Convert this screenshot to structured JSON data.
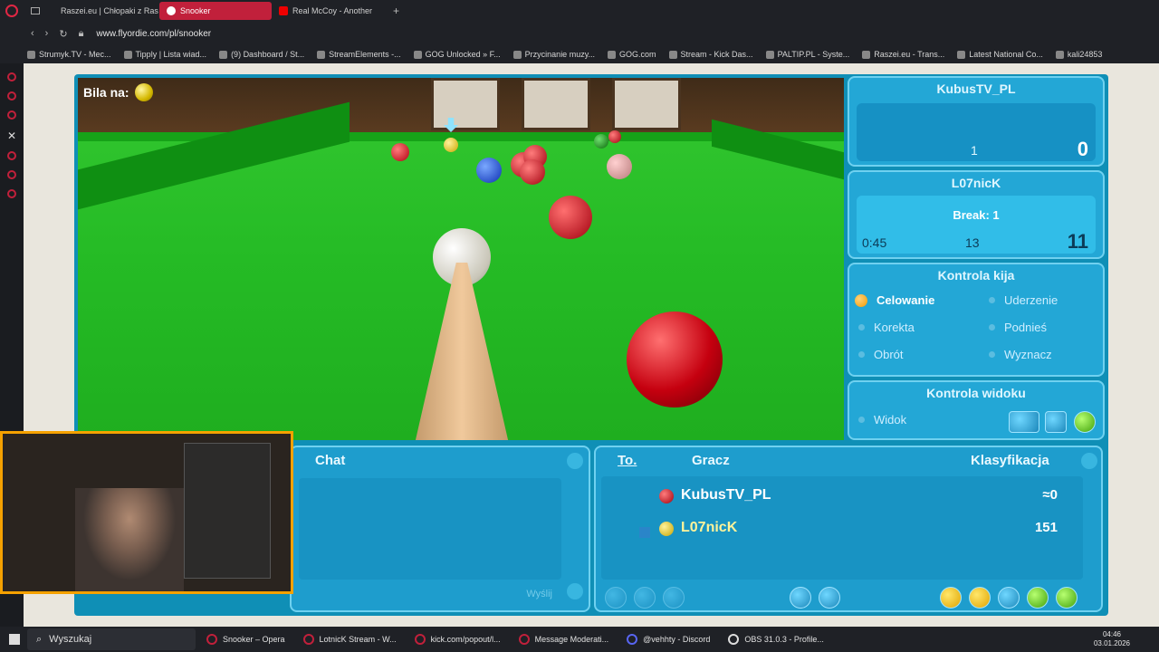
{
  "browser": {
    "tabs": [
      {
        "label": "Raszei.eu | Chłopaki z Ras",
        "active": false,
        "icon": "raszei-icon"
      },
      {
        "label": "Snooker",
        "active": true,
        "icon": "opera-icon"
      },
      {
        "label": "Real McCoy - Another",
        "active": false,
        "icon": "youtube-icon"
      }
    ],
    "url": "www.flyordie.com/pl/snooker",
    "bookmarks": [
      "Strumyk.TV - Mec...",
      "Tipply | Lista wiad...",
      "(9) Dashboard / St...",
      "StreamElements -...",
      "GOG Unlocked » F...",
      "Przycinanie muzy...",
      "GOG.com",
      "Stream - Kick Das...",
      "PALTIP.PL - Syste...",
      "Raszei.eu - Trans...",
      "Latest National Co...",
      "kali24853"
    ]
  },
  "game": {
    "cue_ball_label": "Bila na:",
    "player1": {
      "name": "KubusTV_PL",
      "frames": "1",
      "score": "0"
    },
    "player2": {
      "name": "L07nicK",
      "break": "Break: 1",
      "time": "0:45",
      "frames": "13",
      "score": "11"
    },
    "cue_control": {
      "title": "Kontrola kija",
      "items": [
        {
          "label": "Celowanie",
          "selected": true
        },
        {
          "label": "Uderzenie",
          "selected": false
        },
        {
          "label": "Korekta",
          "selected": false
        },
        {
          "label": "Podnieś",
          "selected": false
        },
        {
          "label": "Obrót",
          "selected": false
        },
        {
          "label": "Wyznacz",
          "selected": false
        }
      ]
    },
    "view_control": {
      "title": "Kontrola widoku",
      "item": "Widok"
    },
    "chat": {
      "title": "Chat",
      "send": "Wyślij"
    },
    "players_table": {
      "col_to": "To.",
      "col_player": "Gracz",
      "col_rank": "Klasyfikacja",
      "rows": [
        {
          "name": "KubusTV_PL",
          "rank": "≈0",
          "ball_color": "#c8101a"
        },
        {
          "name": "L07nicK",
          "rank": "151",
          "ball_color": "#e2c300"
        }
      ]
    }
  },
  "taskbar": {
    "search": "Wyszukaj",
    "items": [
      "Snooker – Opera",
      "LotnicK Stream - W...",
      "kick.com/popout/l...",
      "Message Moderati...",
      "@vehhty - Discord",
      "OBS 31.0.3 - Profile..."
    ],
    "time": "04:46",
    "date": "03.01.2026"
  },
  "colors": {
    "accent": "#c1203b",
    "game_blue": "#23a7d6",
    "felt": "#25bb25"
  }
}
